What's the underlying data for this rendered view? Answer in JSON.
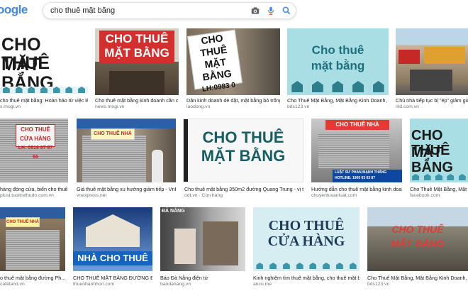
{
  "header": {
    "logo": "oogle",
    "search_value": "cho thuê mặt bằng"
  },
  "results": [
    {
      "caption": "cho thuê mặt bằng: Hoàn hảo từ việc lên ý ...",
      "source": "s.mogi.vn",
      "sign": [
        "CHO THUÊ",
        "MẶT BẰNG"
      ]
    },
    {
      "caption": "Cho thuê mặt bằng kinh doanh cần chú...",
      "source": "news.mogi.vn",
      "sign": [
        "CHO THUÊ",
        "MẶT BẰNG"
      ]
    },
    {
      "caption": "Dân kinh doanh dè dặt, mặt bằng bỏ trống ở TPHCM...",
      "source": "laodong.vn",
      "sign": [
        "CHO THUÊ",
        "MẶT BẰNG",
        "LH:0983 0"
      ]
    },
    {
      "caption": "Cho Thuê Mặt Bằng, Mặt Bằng Kinh Doanh, Giá...",
      "source": "bds123.vn",
      "sign": [
        "Cho thuê",
        "mặt bằng"
      ]
    },
    {
      "caption": "Chủ nhà tiếp tục bị \"ép\" giảm giá th",
      "source": "nld.com.vn",
      "sign": []
    },
    {
      "caption": "hàng đóng cửa, biển cho thuê ...",
      "source": "plust.tuoitrethudo.com.vn",
      "sign": [
        "CHO THUÊ CỬA HÀNG",
        "LH: 0916 97 67 66"
      ]
    },
    {
      "caption": "Giá thuê mặt bằng xu hướng giảm tiếp - VnExp...",
      "source": "vnexpress.net",
      "sign": [
        "CHO THUÊ NHÀ"
      ]
    },
    {
      "caption": "Cho thuê mặt bằng 350m2 đường Quang Trung - vị trí đẹ...",
      "source": "odt.vn · Còn hàng",
      "sign": [
        "CHO THUÊ",
        "MẶT BẰNG"
      ]
    },
    {
      "caption": "Hướng dẫn cho thuê mặt bằng kinh doanh...",
      "source": "chuyentuvanluat.com",
      "sign": [
        "CHO THUÊ NHÀ",
        "LUẬT SƯ PHAN MẠNH THẮNG",
        "HOTLINE: 1900 63 63 87"
      ]
    },
    {
      "caption": "Cho Thuê Mặt Bằng, Mặt Bằng Kinh Do...",
      "source": "facebook.com",
      "sign": [
        "CHO THUÊ",
        "MẶT BẰNG"
      ]
    },
    {
      "caption": "o thuê mặt bằng đường Ph...",
      "source": "cafeland.vn",
      "sign": [
        "CHO THUÊ NHÀ"
      ]
    },
    {
      "caption": "CHO THUÊ MẶT BẰNG ĐƯỜNG ĐỒN...",
      "source": "thuenhanhhon.com",
      "sign": [
        "NHÀ CHO THUÊ"
      ]
    },
    {
      "caption": "Báo Đà Nẵng điện tử",
      "source": "baodanang.vn",
      "sign": [
        "ĐÀ NẴNG"
      ]
    },
    {
      "caption": "Kinh nghiệm tìm thuê mặt bằng, cho thuê mặt bằng...",
      "source": "ancu.me",
      "sign": [
        "CHO THUÊ",
        "CỬA HÀNG"
      ]
    },
    {
      "caption": "Cho Thuê Mặt Bằng, Mặt Bằng Kinh Doanh, Giá...",
      "source": "bds123.vn",
      "sign": [
        "CHO THUÊ",
        "MẶT BẰNG"
      ]
    }
  ],
  "colors": {
    "teal": "#3a96a8",
    "dark_text": "#1a1a1a",
    "sign_red": "#d32f2f"
  },
  "icons": [
    "camera-icon",
    "mic-icon",
    "search-icon"
  ]
}
